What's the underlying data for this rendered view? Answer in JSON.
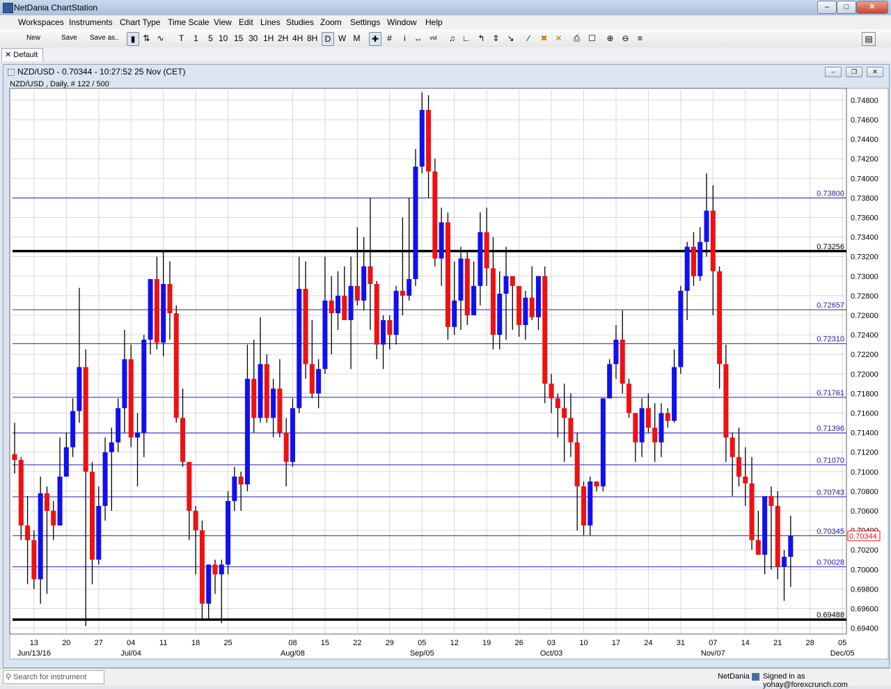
{
  "app": {
    "title": "NetDania ChartStation",
    "min_label": "–",
    "max_label": "□",
    "close_label": "✕"
  },
  "menu": [
    "Workspaces",
    "Instruments",
    "Chart Type",
    "Time Scale",
    "View",
    "Edit",
    "Lines",
    "Studies",
    "Zoom",
    "Settings",
    "Window",
    "Help"
  ],
  "toolbar": {
    "new_label": "New",
    "save_label": "Save",
    "save_as_label": "Save as..",
    "timescales": [
      "T",
      "1",
      "5",
      "10",
      "15",
      "30",
      "1H",
      "2H",
      "4H",
      "8H",
      "D",
      "W",
      "M"
    ],
    "active_timescale": "D"
  },
  "tabs": {
    "default_label": "Default"
  },
  "chart_window": {
    "title": "NZD/USD - 0.70344 - 10:27:52  25 Nov (CET)",
    "subtitle": "NZD/USD , Daily, # 122 / 500"
  },
  "status": {
    "search_placeholder": "Search for instrument",
    "brand": "NetDania",
    "signed_in": "Signed in as yohay@forexcrunch.com"
  },
  "colors": {
    "up": "#1010f0",
    "down": "#f01010",
    "hline": "#2020b0",
    "grid": "#d8d8d8",
    "background": "#ffffff"
  },
  "chart_data": {
    "type": "candlestick",
    "symbol": "NZD/USD",
    "ylim": [
      0.6934,
      0.7492
    ],
    "yticks": [
      "0.69400",
      "0.69600",
      "0.69800",
      "0.70000",
      "0.70200",
      "0.70400",
      "0.70600",
      "0.70800",
      "0.71000",
      "0.71200",
      "0.71400",
      "0.71600",
      "0.71800",
      "0.72000",
      "0.72200",
      "0.72400",
      "0.72600",
      "0.72800",
      "0.73000",
      "0.73200",
      "0.73400",
      "0.73600",
      "0.73800",
      "0.74000",
      "0.74200",
      "0.74400",
      "0.74600",
      "0.74800"
    ],
    "current_price": "0.70344",
    "xticks": [
      {
        "i": 3,
        "label": "13",
        "sub": "Jun/13/16"
      },
      {
        "i": 8,
        "label": "20",
        "sub": ""
      },
      {
        "i": 13,
        "label": "27",
        "sub": ""
      },
      {
        "i": 18,
        "label": "04",
        "sub": "Jul/04"
      },
      {
        "i": 23,
        "label": "11",
        "sub": ""
      },
      {
        "i": 28,
        "label": "18",
        "sub": ""
      },
      {
        "i": 33,
        "label": "25",
        "sub": ""
      },
      {
        "i": 43,
        "label": "08",
        "sub": "Aug/08"
      },
      {
        "i": 48,
        "label": "15",
        "sub": ""
      },
      {
        "i": 53,
        "label": "22",
        "sub": ""
      },
      {
        "i": 58,
        "label": "29",
        "sub": ""
      },
      {
        "i": 63,
        "label": "05",
        "sub": "Sep/05"
      },
      {
        "i": 68,
        "label": "12",
        "sub": ""
      },
      {
        "i": 73,
        "label": "19",
        "sub": ""
      },
      {
        "i": 78,
        "label": "26",
        "sub": ""
      },
      {
        "i": 83,
        "label": "03",
        "sub": "Oct/03"
      },
      {
        "i": 88,
        "label": "10",
        "sub": ""
      },
      {
        "i": 93,
        "label": "17",
        "sub": ""
      },
      {
        "i": 98,
        "label": "24",
        "sub": ""
      },
      {
        "i": 103,
        "label": "31",
        "sub": ""
      },
      {
        "i": 108,
        "label": "07",
        "sub": "Nov/07"
      },
      {
        "i": 113,
        "label": "14",
        "sub": ""
      },
      {
        "i": 118,
        "label": "21",
        "sub": ""
      },
      {
        "i": 123,
        "label": "28",
        "sub": ""
      },
      {
        "i": 128,
        "label": "05",
        "sub": "Dec/05"
      }
    ],
    "hlines": [
      {
        "value": 0.738,
        "label": "0.73800",
        "thick": false
      },
      {
        "value": 0.73256,
        "label": "0.73256",
        "thick": true
      },
      {
        "value": 0.72657,
        "label": "0.72657",
        "thick": false
      },
      {
        "value": 0.7231,
        "label": "0.72310",
        "thick": false
      },
      {
        "value": 0.71761,
        "label": "0.71761",
        "thick": false
      },
      {
        "value": 0.71396,
        "label": "0.71396",
        "thick": false
      },
      {
        "value": 0.7107,
        "label": "0.71070",
        "thick": false
      },
      {
        "value": 0.70743,
        "label": "0.70743",
        "thick": false
      },
      {
        "value": 0.70345,
        "label": "0.70345",
        "thick": false
      },
      {
        "value": 0.70028,
        "label": "0.70028",
        "thick": false
      },
      {
        "value": 0.69488,
        "label": "0.69488",
        "thick": true
      }
    ],
    "candles": [
      [
        0.7118,
        0.715,
        0.7098,
        0.7112
      ],
      [
        0.7112,
        0.7115,
        0.703,
        0.7045
      ],
      [
        0.7045,
        0.7075,
        0.6985,
        0.703
      ],
      [
        0.703,
        0.704,
        0.698,
        0.699
      ],
      [
        0.699,
        0.7095,
        0.6965,
        0.7078
      ],
      [
        0.7078,
        0.7085,
        0.6975,
        0.706
      ],
      [
        0.706,
        0.707,
        0.703,
        0.7045
      ],
      [
        0.7045,
        0.7135,
        0.7075,
        0.7095
      ],
      [
        0.7095,
        0.714,
        0.711,
        0.7125
      ],
      [
        0.7125,
        0.7175,
        0.7115,
        0.7162
      ],
      [
        0.7162,
        0.7288,
        0.715,
        0.7207
      ],
      [
        0.7207,
        0.7225,
        0.6942,
        0.71
      ],
      [
        0.71,
        0.711,
        0.6985,
        0.701
      ],
      [
        0.701,
        0.7085,
        0.7005,
        0.7065
      ],
      [
        0.7065,
        0.7135,
        0.705,
        0.712
      ],
      [
        0.712,
        0.7145,
        0.706,
        0.713
      ],
      [
        0.713,
        0.7175,
        0.712,
        0.7165
      ],
      [
        0.7165,
        0.7245,
        0.714,
        0.7215
      ],
      [
        0.7215,
        0.723,
        0.7125,
        0.7135
      ],
      [
        0.7135,
        0.716,
        0.7085,
        0.714
      ],
      [
        0.714,
        0.724,
        0.7115,
        0.7235
      ],
      [
        0.7235,
        0.727,
        0.722,
        0.7297
      ],
      [
        0.7297,
        0.732,
        0.7225,
        0.7232
      ],
      [
        0.7232,
        0.7325,
        0.7218,
        0.7292
      ],
      [
        0.7292,
        0.7315,
        0.7235,
        0.7262
      ],
      [
        0.7262,
        0.727,
        0.715,
        0.7155
      ],
      [
        0.7155,
        0.7185,
        0.7105,
        0.711
      ],
      [
        0.711,
        0.709,
        0.703,
        0.706
      ],
      [
        0.706,
        0.7065,
        0.6995,
        0.704
      ],
      [
        0.704,
        0.705,
        0.695,
        0.6965
      ],
      [
        0.6965,
        0.6985,
        0.695,
        0.7005
      ],
      [
        0.7005,
        0.701,
        0.6975,
        0.6995
      ],
      [
        0.6995,
        0.701,
        0.6945,
        0.7005
      ],
      [
        0.7005,
        0.708,
        0.6995,
        0.707
      ],
      [
        0.707,
        0.7105,
        0.706,
        0.7095
      ],
      [
        0.7095,
        0.71,
        0.706,
        0.7087
      ],
      [
        0.7087,
        0.723,
        0.708,
        0.7195
      ],
      [
        0.7195,
        0.7235,
        0.714,
        0.7155
      ],
      [
        0.7155,
        0.7258,
        0.715,
        0.721
      ],
      [
        0.721,
        0.722,
        0.715,
        0.7155
      ],
      [
        0.7155,
        0.7195,
        0.7135,
        0.7185
      ],
      [
        0.7185,
        0.7215,
        0.7135,
        0.714
      ],
      [
        0.714,
        0.7155,
        0.7085,
        0.711
      ],
      [
        0.711,
        0.7175,
        0.7105,
        0.7165
      ],
      [
        0.7165,
        0.732,
        0.716,
        0.7287
      ],
      [
        0.7287,
        0.7315,
        0.7195,
        0.721
      ],
      [
        0.721,
        0.7255,
        0.7175,
        0.718
      ],
      [
        0.718,
        0.7215,
        0.7165,
        0.7205
      ],
      [
        0.7205,
        0.732,
        0.72,
        0.7275
      ],
      [
        0.7275,
        0.73,
        0.722,
        0.7262
      ],
      [
        0.7262,
        0.7305,
        0.7245,
        0.728
      ],
      [
        0.728,
        0.731,
        0.7265,
        0.7255
      ],
      [
        0.7255,
        0.732,
        0.7205,
        0.729
      ],
      [
        0.729,
        0.735,
        0.727,
        0.7275
      ],
      [
        0.7275,
        0.734,
        0.7265,
        0.731
      ],
      [
        0.731,
        0.738,
        0.7245,
        0.7292
      ],
      [
        0.7292,
        0.7295,
        0.7215,
        0.723
      ],
      [
        0.723,
        0.726,
        0.7205,
        0.7255
      ],
      [
        0.7255,
        0.726,
        0.7225,
        0.724
      ],
      [
        0.724,
        0.729,
        0.723,
        0.7285
      ],
      [
        0.7285,
        0.736,
        0.726,
        0.728
      ],
      [
        0.728,
        0.738,
        0.7275,
        0.7297
      ],
      [
        0.7297,
        0.743,
        0.729,
        0.7412
      ],
      [
        0.7412,
        0.7488,
        0.7405,
        0.747
      ],
      [
        0.747,
        0.7485,
        0.738,
        0.7407
      ],
      [
        0.7407,
        0.742,
        0.731,
        0.7318
      ],
      [
        0.7318,
        0.737,
        0.729,
        0.7355
      ],
      [
        0.7355,
        0.7365,
        0.7235,
        0.7248
      ],
      [
        0.7248,
        0.7315,
        0.724,
        0.7275
      ],
      [
        0.7275,
        0.733,
        0.7245,
        0.7318
      ],
      [
        0.7318,
        0.7325,
        0.725,
        0.726
      ],
      [
        0.726,
        0.7315,
        0.7262,
        0.729
      ],
      [
        0.729,
        0.7365,
        0.727,
        0.7345
      ],
      [
        0.7345,
        0.737,
        0.729,
        0.7308
      ],
      [
        0.7308,
        0.734,
        0.7225,
        0.724
      ],
      [
        0.724,
        0.7305,
        0.7225,
        0.7282
      ],
      [
        0.7282,
        0.733,
        0.7235,
        0.73
      ],
      [
        0.73,
        0.73,
        0.7245,
        0.729
      ],
      [
        0.729,
        0.729,
        0.7238,
        0.725
      ],
      [
        0.725,
        0.7285,
        0.7235,
        0.7278
      ],
      [
        0.7278,
        0.731,
        0.7255,
        0.7258
      ],
      [
        0.7258,
        0.73,
        0.7245,
        0.73
      ],
      [
        0.73,
        0.731,
        0.717,
        0.719
      ],
      [
        0.719,
        0.72,
        0.716,
        0.7175
      ],
      [
        0.7175,
        0.718,
        0.7135,
        0.7165
      ],
      [
        0.7165,
        0.719,
        0.711,
        0.7155
      ],
      [
        0.7155,
        0.718,
        0.7115,
        0.713
      ],
      [
        0.713,
        0.714,
        0.704,
        0.7085
      ],
      [
        0.7085,
        0.709,
        0.7035,
        0.7045
      ],
      [
        0.7045,
        0.7095,
        0.7035,
        0.709
      ],
      [
        0.709,
        0.7085,
        0.708,
        0.7085
      ],
      [
        0.7085,
        0.7175,
        0.708,
        0.7175
      ],
      [
        0.7175,
        0.7215,
        0.7175,
        0.721
      ],
      [
        0.721,
        0.725,
        0.7195,
        0.7235
      ],
      [
        0.7235,
        0.7265,
        0.718,
        0.719
      ],
      [
        0.719,
        0.7195,
        0.7155,
        0.716
      ],
      [
        0.716,
        0.714,
        0.711,
        0.713
      ],
      [
        0.713,
        0.7175,
        0.7115,
        0.7165
      ],
      [
        0.7165,
        0.718,
        0.714,
        0.7145
      ],
      [
        0.7145,
        0.717,
        0.711,
        0.713
      ],
      [
        0.713,
        0.717,
        0.7115,
        0.716
      ],
      [
        0.716,
        0.7165,
        0.7145,
        0.7152
      ],
      [
        0.7152,
        0.7225,
        0.715,
        0.7207
      ],
      [
        0.7207,
        0.729,
        0.72,
        0.7285
      ],
      [
        0.7285,
        0.7335,
        0.7255,
        0.733
      ],
      [
        0.733,
        0.7345,
        0.729,
        0.73
      ],
      [
        0.73,
        0.735,
        0.7295,
        0.7335
      ],
      [
        0.7335,
        0.7405,
        0.732,
        0.7367
      ],
      [
        0.7367,
        0.7393,
        0.726,
        0.7305
      ],
      [
        0.7305,
        0.731,
        0.7185,
        0.721
      ],
      [
        0.721,
        0.723,
        0.711,
        0.7135
      ],
      [
        0.7135,
        0.714,
        0.7075,
        0.7115
      ],
      [
        0.7115,
        0.7145,
        0.7085,
        0.7095
      ],
      [
        0.7095,
        0.7125,
        0.7065,
        0.7088
      ],
      [
        0.7088,
        0.7115,
        0.702,
        0.703
      ],
      [
        0.703,
        0.706,
        0.7015,
        0.7015
      ],
      [
        0.7015,
        0.7075,
        0.6995,
        0.7075
      ],
      [
        0.7075,
        0.7085,
        0.7,
        0.7065
      ],
      [
        0.7065,
        0.708,
        0.699,
        0.7003
      ],
      [
        0.7003,
        0.702,
        0.6968,
        0.7013
      ],
      [
        0.7013,
        0.7055,
        0.6982,
        0.70344
      ]
    ]
  }
}
